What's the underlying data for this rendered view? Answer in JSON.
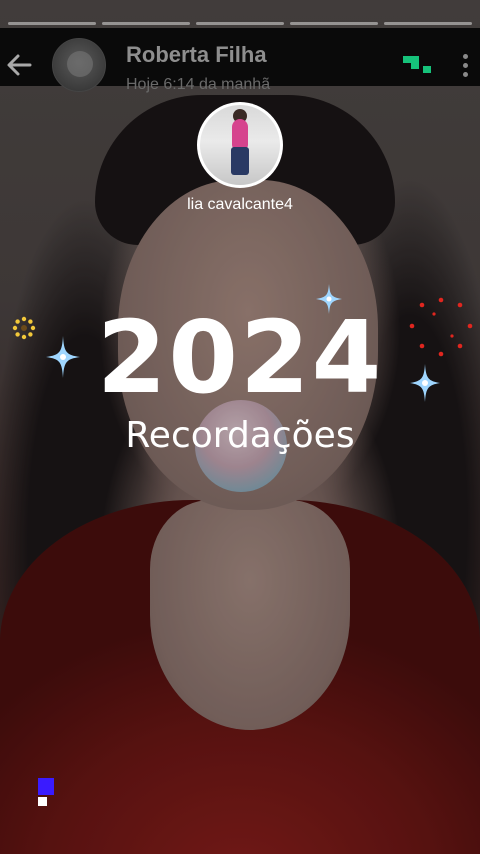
{
  "header": {
    "contact_name": "Roberta Filha",
    "timestamp": "Hoje 6:14 da manhã",
    "back_icon": "arrow-left-icon",
    "menu_icon": "more-vertical-icon"
  },
  "story": {
    "username": "lia cavalcante4",
    "year": "2024",
    "subtitle": "Recordações"
  },
  "colors": {
    "pixel_accent": "#16c27a",
    "sparkle_blue": "#9fd6ff",
    "sparkle_gold": "#f2c83a",
    "sparkle_red": "#e0261f",
    "corner_square": "#3a1bff"
  }
}
